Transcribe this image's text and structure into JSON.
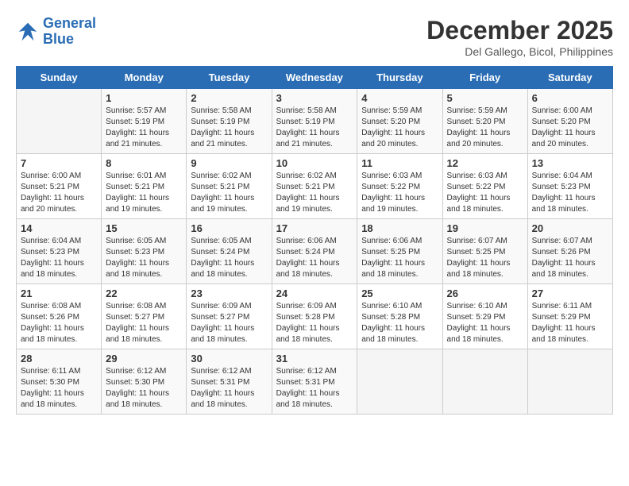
{
  "logo": {
    "line1": "General",
    "line2": "Blue"
  },
  "header": {
    "month_year": "December 2025",
    "location": "Del Gallego, Bicol, Philippines"
  },
  "days_of_week": [
    "Sunday",
    "Monday",
    "Tuesday",
    "Wednesday",
    "Thursday",
    "Friday",
    "Saturday"
  ],
  "weeks": [
    [
      {
        "day": "",
        "sunrise": "",
        "sunset": "",
        "daylight": ""
      },
      {
        "day": "1",
        "sunrise": "Sunrise: 5:57 AM",
        "sunset": "Sunset: 5:19 PM",
        "daylight": "Daylight: 11 hours and 21 minutes."
      },
      {
        "day": "2",
        "sunrise": "Sunrise: 5:58 AM",
        "sunset": "Sunset: 5:19 PM",
        "daylight": "Daylight: 11 hours and 21 minutes."
      },
      {
        "day": "3",
        "sunrise": "Sunrise: 5:58 AM",
        "sunset": "Sunset: 5:19 PM",
        "daylight": "Daylight: 11 hours and 21 minutes."
      },
      {
        "day": "4",
        "sunrise": "Sunrise: 5:59 AM",
        "sunset": "Sunset: 5:20 PM",
        "daylight": "Daylight: 11 hours and 20 minutes."
      },
      {
        "day": "5",
        "sunrise": "Sunrise: 5:59 AM",
        "sunset": "Sunset: 5:20 PM",
        "daylight": "Daylight: 11 hours and 20 minutes."
      },
      {
        "day": "6",
        "sunrise": "Sunrise: 6:00 AM",
        "sunset": "Sunset: 5:20 PM",
        "daylight": "Daylight: 11 hours and 20 minutes."
      }
    ],
    [
      {
        "day": "7",
        "sunrise": "Sunrise: 6:00 AM",
        "sunset": "Sunset: 5:21 PM",
        "daylight": "Daylight: 11 hours and 20 minutes."
      },
      {
        "day": "8",
        "sunrise": "Sunrise: 6:01 AM",
        "sunset": "Sunset: 5:21 PM",
        "daylight": "Daylight: 11 hours and 19 minutes."
      },
      {
        "day": "9",
        "sunrise": "Sunrise: 6:02 AM",
        "sunset": "Sunset: 5:21 PM",
        "daylight": "Daylight: 11 hours and 19 minutes."
      },
      {
        "day": "10",
        "sunrise": "Sunrise: 6:02 AM",
        "sunset": "Sunset: 5:21 PM",
        "daylight": "Daylight: 11 hours and 19 minutes."
      },
      {
        "day": "11",
        "sunrise": "Sunrise: 6:03 AM",
        "sunset": "Sunset: 5:22 PM",
        "daylight": "Daylight: 11 hours and 19 minutes."
      },
      {
        "day": "12",
        "sunrise": "Sunrise: 6:03 AM",
        "sunset": "Sunset: 5:22 PM",
        "daylight": "Daylight: 11 hours and 18 minutes."
      },
      {
        "day": "13",
        "sunrise": "Sunrise: 6:04 AM",
        "sunset": "Sunset: 5:23 PM",
        "daylight": "Daylight: 11 hours and 18 minutes."
      }
    ],
    [
      {
        "day": "14",
        "sunrise": "Sunrise: 6:04 AM",
        "sunset": "Sunset: 5:23 PM",
        "daylight": "Daylight: 11 hours and 18 minutes."
      },
      {
        "day": "15",
        "sunrise": "Sunrise: 6:05 AM",
        "sunset": "Sunset: 5:23 PM",
        "daylight": "Daylight: 11 hours and 18 minutes."
      },
      {
        "day": "16",
        "sunrise": "Sunrise: 6:05 AM",
        "sunset": "Sunset: 5:24 PM",
        "daylight": "Daylight: 11 hours and 18 minutes."
      },
      {
        "day": "17",
        "sunrise": "Sunrise: 6:06 AM",
        "sunset": "Sunset: 5:24 PM",
        "daylight": "Daylight: 11 hours and 18 minutes."
      },
      {
        "day": "18",
        "sunrise": "Sunrise: 6:06 AM",
        "sunset": "Sunset: 5:25 PM",
        "daylight": "Daylight: 11 hours and 18 minutes."
      },
      {
        "day": "19",
        "sunrise": "Sunrise: 6:07 AM",
        "sunset": "Sunset: 5:25 PM",
        "daylight": "Daylight: 11 hours and 18 minutes."
      },
      {
        "day": "20",
        "sunrise": "Sunrise: 6:07 AM",
        "sunset": "Sunset: 5:26 PM",
        "daylight": "Daylight: 11 hours and 18 minutes."
      }
    ],
    [
      {
        "day": "21",
        "sunrise": "Sunrise: 6:08 AM",
        "sunset": "Sunset: 5:26 PM",
        "daylight": "Daylight: 11 hours and 18 minutes."
      },
      {
        "day": "22",
        "sunrise": "Sunrise: 6:08 AM",
        "sunset": "Sunset: 5:27 PM",
        "daylight": "Daylight: 11 hours and 18 minutes."
      },
      {
        "day": "23",
        "sunrise": "Sunrise: 6:09 AM",
        "sunset": "Sunset: 5:27 PM",
        "daylight": "Daylight: 11 hours and 18 minutes."
      },
      {
        "day": "24",
        "sunrise": "Sunrise: 6:09 AM",
        "sunset": "Sunset: 5:28 PM",
        "daylight": "Daylight: 11 hours and 18 minutes."
      },
      {
        "day": "25",
        "sunrise": "Sunrise: 6:10 AM",
        "sunset": "Sunset: 5:28 PM",
        "daylight": "Daylight: 11 hours and 18 minutes."
      },
      {
        "day": "26",
        "sunrise": "Sunrise: 6:10 AM",
        "sunset": "Sunset: 5:29 PM",
        "daylight": "Daylight: 11 hours and 18 minutes."
      },
      {
        "day": "27",
        "sunrise": "Sunrise: 6:11 AM",
        "sunset": "Sunset: 5:29 PM",
        "daylight": "Daylight: 11 hours and 18 minutes."
      }
    ],
    [
      {
        "day": "28",
        "sunrise": "Sunrise: 6:11 AM",
        "sunset": "Sunset: 5:30 PM",
        "daylight": "Daylight: 11 hours and 18 minutes."
      },
      {
        "day": "29",
        "sunrise": "Sunrise: 6:12 AM",
        "sunset": "Sunset: 5:30 PM",
        "daylight": "Daylight: 11 hours and 18 minutes."
      },
      {
        "day": "30",
        "sunrise": "Sunrise: 6:12 AM",
        "sunset": "Sunset: 5:31 PM",
        "daylight": "Daylight: 11 hours and 18 minutes."
      },
      {
        "day": "31",
        "sunrise": "Sunrise: 6:12 AM",
        "sunset": "Sunset: 5:31 PM",
        "daylight": "Daylight: 11 hours and 18 minutes."
      },
      {
        "day": "",
        "sunrise": "",
        "sunset": "",
        "daylight": ""
      },
      {
        "day": "",
        "sunrise": "",
        "sunset": "",
        "daylight": ""
      },
      {
        "day": "",
        "sunrise": "",
        "sunset": "",
        "daylight": ""
      }
    ]
  ]
}
